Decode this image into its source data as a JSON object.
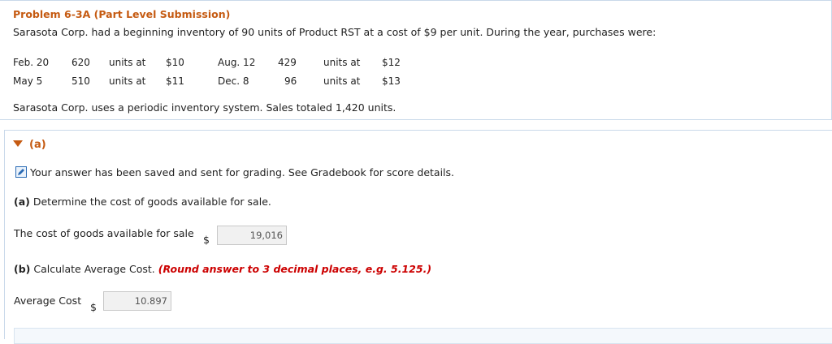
{
  "problem": {
    "title": "Problem 6-3A (Part Level Submission)",
    "intro": "Sarasota Corp. had a beginning inventory of 90 units of Product RST at a cost of $9 per unit. During the year, purchases were:",
    "purchases": [
      {
        "date": "Feb. 20",
        "qty": "620",
        "units": "units at",
        "cost": "$10",
        "date2": "Aug. 12",
        "qty2": "429",
        "units2": "units at",
        "cost2": "$12"
      },
      {
        "date": "May 5",
        "qty": "510",
        "units": "units at",
        "cost": "$11",
        "date2": "Dec. 8",
        "qty2": "96",
        "units2": "units at",
        "cost2": "$13"
      }
    ],
    "summary": "Sarasota Corp. uses a periodic inventory system. Sales totaled 1,420 units."
  },
  "part": {
    "label": "(a)",
    "saved_msg": "Your answer has been saved and sent for grading. See Gradebook for score details.",
    "q_a_prefix": "(a)",
    "q_a_text": "Determine the cost of goods available for sale.",
    "cogs_label": "The cost of goods available for sale",
    "currency": "$",
    "cogs_value": "19,016",
    "q_b_prefix": "(b)",
    "q_b_text": "Calculate Average Cost.",
    "q_b_note": "(Round answer to 3 decimal places, e.g. 5.125.)",
    "avg_label": "Average Cost",
    "avg_value": "10.897"
  },
  "colors": {
    "accent": "#c55a11",
    "note": "#cc0000",
    "border": "#c9d9ea"
  }
}
